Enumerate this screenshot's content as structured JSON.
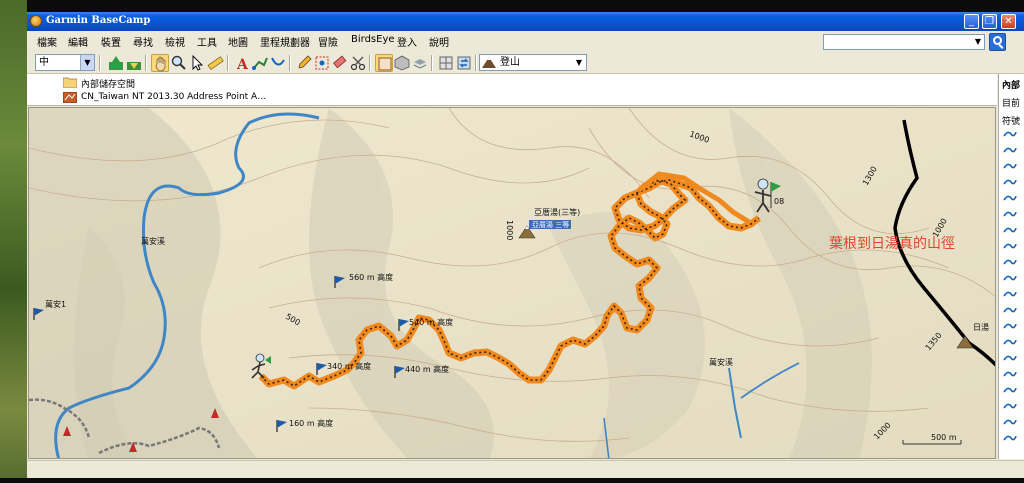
{
  "app": {
    "title": "Garmin BaseCamp"
  },
  "menu": [
    "檔案",
    "編輯",
    "裝置",
    "尋找",
    "檢視",
    "工具",
    "地圖",
    "里程規劃器",
    "冒險",
    "BirdsEye",
    "登入",
    "說明"
  ],
  "toolbar": {
    "zoom_value": "中",
    "activity_value": "登山"
  },
  "library": {
    "items": [
      "內部儲存空間",
      "CN_Taiwan NT 2013.30 Address Point A…"
    ]
  },
  "right_panel": {
    "header": "內部",
    "sub": "目前",
    "col": "符號"
  },
  "map": {
    "annotation": "葉根到日湯真的山徑",
    "peak_label": "亞厝湯(三等)",
    "peak_sub": "亞厝湯 三等",
    "end_label": "日湯",
    "waypoints": [
      "560 m 高度",
      "540 m 高度",
      "340 m 高度",
      "440 m 高度",
      "160 m 高度"
    ],
    "places": [
      "萬安溪",
      "萬安1",
      "萬安溪"
    ],
    "contours": [
      "1000",
      "1300",
      "1000",
      "500",
      "1350",
      "1000",
      "1000"
    ],
    "scale": "500 m",
    "flag_num": "08"
  },
  "colors": {
    "track": "#f08a1e",
    "river": "#3f86c6",
    "terrain": "#ece4c8"
  }
}
